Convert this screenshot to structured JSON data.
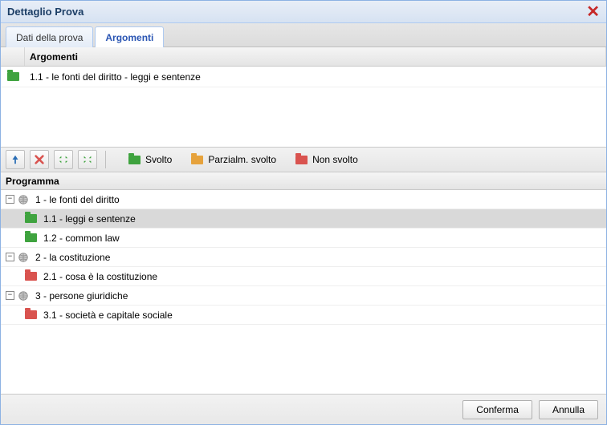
{
  "window": {
    "title": "Dettaglio Prova"
  },
  "tabs": {
    "data": "Dati della prova",
    "arg": "Argomenti"
  },
  "argGrid": {
    "header": "Argomenti",
    "rows": [
      {
        "folder": "green",
        "text": "1.1 - le fonti del diritto - leggi e sentenze"
      }
    ]
  },
  "legend": {
    "svolto": "Svolto",
    "parz": "Parzialm. svolto",
    "non": "Non svolto"
  },
  "program": {
    "header": "Programma",
    "nodes": [
      {
        "type": "parent",
        "label": "1 - le fonti del diritto"
      },
      {
        "type": "child",
        "folder": "green",
        "label": "1.1 - leggi e sentenze",
        "selected": true
      },
      {
        "type": "child",
        "folder": "green",
        "label": "1.2 - common law"
      },
      {
        "type": "parent",
        "label": "2 - la costituzione"
      },
      {
        "type": "child",
        "folder": "red",
        "label": "2.1 - cosa è la costituzione"
      },
      {
        "type": "parent",
        "label": "3 - persone giuridiche"
      },
      {
        "type": "child",
        "folder": "red",
        "label": "3.1 - società e capitale sociale"
      }
    ]
  },
  "footer": {
    "confirm": "Conferma",
    "cancel": "Annulla"
  }
}
